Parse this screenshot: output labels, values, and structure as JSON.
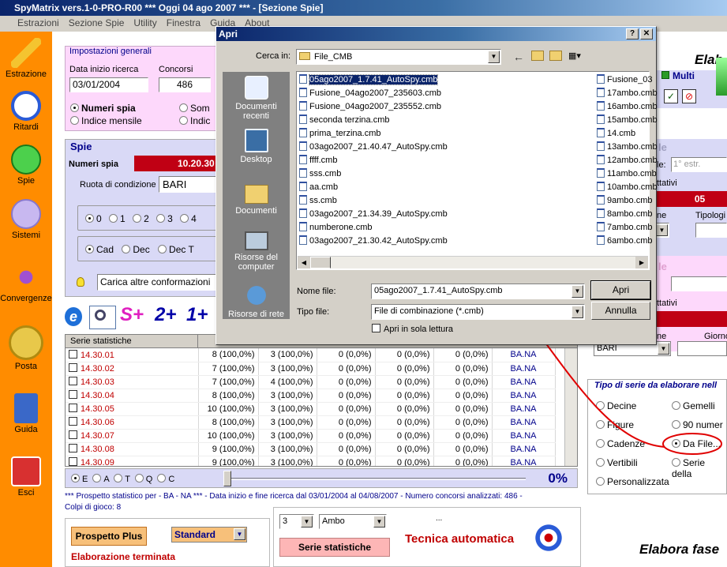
{
  "app": {
    "title": "SpyMatrix vers.1-0-PRO-R00   ***   Oggi 04 ago 2007   ***   - [Sezione Spie]",
    "menu": [
      "Estrazioni",
      "Sezione Spie",
      "Utility",
      "Finestra",
      "Guida",
      "About"
    ]
  },
  "sidebar": {
    "items": [
      {
        "label": "Estrazione",
        "icon": "pencil-icon"
      },
      {
        "label": "Ritardi",
        "icon": "clock-icon"
      },
      {
        "label": "Spie",
        "icon": "flashlight-icon"
      },
      {
        "label": "Sistemi",
        "icon": "lightbulb-icon"
      },
      {
        "label": "Convergenze",
        "icon": "convergence-icon"
      },
      {
        "label": "Posta",
        "icon": "coin-icon"
      },
      {
        "label": "Guida",
        "icon": "book-icon"
      },
      {
        "label": "Esci",
        "icon": "power-icon"
      }
    ]
  },
  "settings": {
    "legend": "Impostazioni generali",
    "start_label": "Data inizio ricerca",
    "start_value": "03/01/2004",
    "concorsi_label": "Concorsi",
    "concorsi_value": "486",
    "radio1": "Numeri spia",
    "radio2": "Indice mensile",
    "radio3": "Som",
    "radio4": "Indic"
  },
  "spie": {
    "legend": "Spie",
    "numeri_label": "Numeri spia",
    "numeri_value": "10.20.30",
    "ruota_label": "Ruota di condizione",
    "ruota_value": "BARI",
    "counts": [
      "0",
      "1",
      "2",
      "3",
      "4",
      "5"
    ],
    "types": [
      "Cad",
      "Dec",
      "Dec T",
      "C"
    ],
    "carica": "Carica altre conformazioni"
  },
  "toolbar": {
    "s_plus": "S+",
    "two_plus": "2+",
    "one_plus": "1+"
  },
  "table": {
    "header": "Serie statistiche",
    "rows": [
      {
        "name": "14.30.01",
        "c1": "8 (100,0%)",
        "c2": "3 (100,0%)",
        "c3": "0 (0,0%)",
        "c4": "0 (0,0%)",
        "c5": "0 (0,0%)",
        "w": "BA.NA"
      },
      {
        "name": "14.30.02",
        "c1": "7 (100,0%)",
        "c2": "3 (100,0%)",
        "c3": "0 (0,0%)",
        "c4": "0 (0,0%)",
        "c5": "0 (0,0%)",
        "w": "BA.NA"
      },
      {
        "name": "14.30.03",
        "c1": "7 (100,0%)",
        "c2": "4 (100,0%)",
        "c3": "0 (0,0%)",
        "c4": "0 (0,0%)",
        "c5": "0 (0,0%)",
        "w": "BA.NA"
      },
      {
        "name": "14.30.04",
        "c1": "8 (100,0%)",
        "c2": "3 (100,0%)",
        "c3": "0 (0,0%)",
        "c4": "0 (0,0%)",
        "c5": "0 (0,0%)",
        "w": "BA.NA"
      },
      {
        "name": "14.30.05",
        "c1": "10 (100,0%)",
        "c2": "3 (100,0%)",
        "c3": "0 (0,0%)",
        "c4": "0 (0,0%)",
        "c5": "0 (0,0%)",
        "w": "BA.NA"
      },
      {
        "name": "14.30.06",
        "c1": "8 (100,0%)",
        "c2": "3 (100,0%)",
        "c3": "0 (0,0%)",
        "c4": "0 (0,0%)",
        "c5": "0 (0,0%)",
        "w": "BA.NA"
      },
      {
        "name": "14.30.07",
        "c1": "10 (100,0%)",
        "c2": "3 (100,0%)",
        "c3": "0 (0,0%)",
        "c4": "0 (0,0%)",
        "c5": "0 (0,0%)",
        "w": "BA.NA"
      },
      {
        "name": "14.30.08",
        "c1": "9 (100,0%)",
        "c2": "3 (100,0%)",
        "c3": "0 (0,0%)",
        "c4": "0 (0,0%)",
        "c5": "0 (0,0%)",
        "w": "BA.NA"
      },
      {
        "name": "14.30.09",
        "c1": "9 (100,0%)",
        "c2": "3 (100,0%)",
        "c3": "0 (0,0%)",
        "c4": "0 (0,0%)",
        "c5": "0 (0,0%)",
        "w": "BA.NA"
      }
    ]
  },
  "progress": {
    "radios": [
      "E",
      "A",
      "T",
      "Q",
      "C"
    ],
    "percent": "0%",
    "fraction": 0
  },
  "info": {
    "line1": "*** Prospetto statistico per  - BA - NA ***  - Data inizio e fine ricerca dal 03/01/2004 al 04/08/2007 - Numero concorsi analizzati: 486 -",
    "line2": "Colpi di gioco: 8"
  },
  "bottom": {
    "prospetto": "Prospetto Plus",
    "standard": "Standard",
    "terminata": "Elaborazione terminata",
    "num": "3",
    "sorte": "Ambo",
    "dots": "...",
    "serie_btn": "Serie statistiche",
    "tecnica": "Tecnica automatica"
  },
  "right": {
    "elab": "Elab",
    "multi": "Multi",
    "estr_label": "le:",
    "estr_value": "1° estr.",
    "ttativi": "ttativi",
    "red_value": "05",
    "tipologia": "Tipologi",
    "ne": "ne",
    "giorno": "Giorno",
    "bari": "BARI",
    "tipo_legend": "Tipo di serie da elaborare nell",
    "options": [
      "Decine",
      "Gemelli",
      "Figure",
      "90 numer",
      "Cadenze",
      "Da File...",
      "Vertibili",
      "Serie della",
      "Personalizzata"
    ],
    "elabora_fase": "Elabora fase"
  },
  "dialog": {
    "title": "Apri",
    "cerca_label": "Cerca in:",
    "folder": "File_CMB",
    "places": [
      "Documenti recenti",
      "Desktop",
      "Documenti",
      "Risorse del computer",
      "Risorse di rete"
    ],
    "files_col1": [
      "05ago2007_1.7.41_AutoSpy.cmb",
      "Fusione_04ago2007_235603.cmb",
      "Fusione_04ago2007_235552.cmb",
      "seconda terzina.cmb",
      "prima_terzina.cmb",
      "03ago2007_21.40.47_AutoSpy.cmb",
      "ffff.cmb",
      "sss.cmb",
      "aa.cmb",
      "ss.cmb",
      "03ago2007_21.34.39_AutoSpy.cmb",
      "numberone.cmb",
      "03ago2007_21.30.42_AutoSpy.cmb"
    ],
    "files_col2": [
      "Fusione_03",
      "17ambo.cmb",
      "16ambo.cmb",
      "15ambo.cmb",
      "14.cmb",
      "13ambo.cmb",
      "12ambo.cmb",
      "11ambo.cmb",
      "10ambo.cmb",
      "9ambo.cmb",
      "8ambo.cmb",
      "7ambo.cmb",
      "6ambo.cmb"
    ],
    "nome_label": "Nome file:",
    "nome_value": "05ago2007_1.7.41_AutoSpy.cmb",
    "tipo_label": "Tipo file:",
    "tipo_value": "File di combinazione (*.cmb)",
    "readonly": "Apri in sola lettura",
    "open": "Apri",
    "cancel": "Annulla"
  }
}
